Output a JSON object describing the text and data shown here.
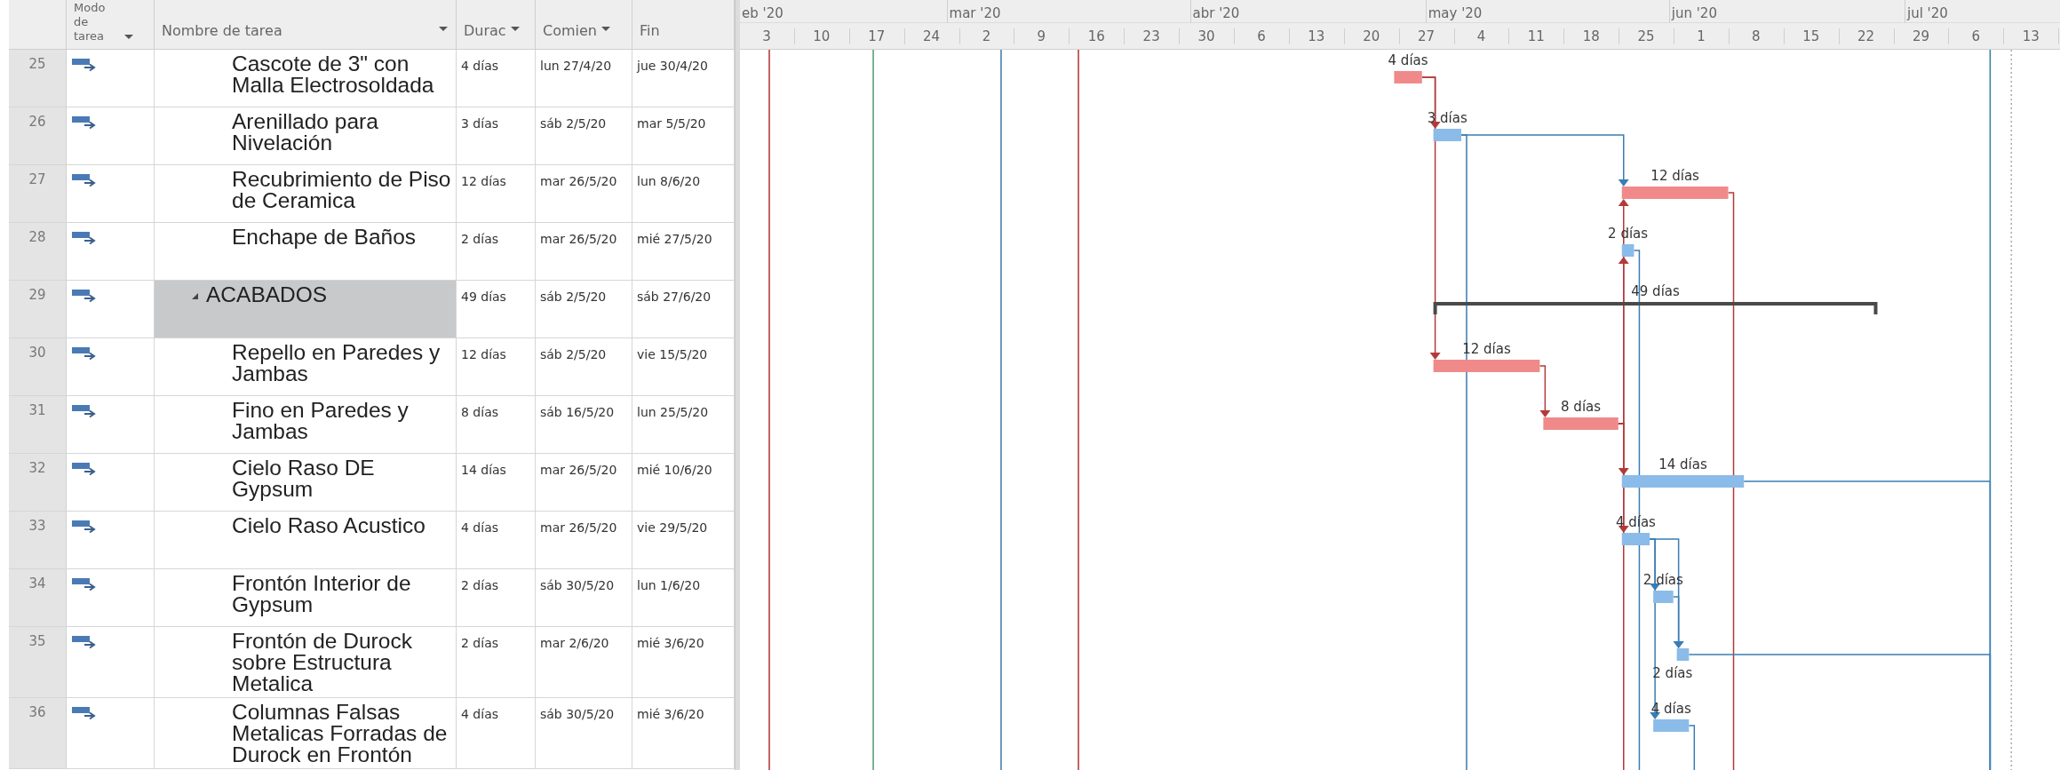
{
  "table": {
    "columns": [
      {
        "label": "Modo de tarea",
        "filter": true
      },
      {
        "label": "Nombre de tarea",
        "filter": true
      },
      {
        "label": "Durac",
        "filter": true
      },
      {
        "label": "Comien",
        "filter": true
      },
      {
        "label": "Fin",
        "filter": false
      }
    ]
  },
  "timescale": {
    "months": [
      "eb '20",
      "mar '20",
      "abr '20",
      "may '20",
      "jun '20",
      "jul '20"
    ],
    "weeks": [
      "3",
      "10",
      "17",
      "24",
      "2",
      "9",
      "16",
      "23",
      "30",
      "6",
      "13",
      "20",
      "27",
      "4",
      "11",
      "18",
      "25",
      "1",
      "8",
      "15",
      "22",
      "29",
      "6",
      "13"
    ]
  },
  "tasks": [
    {
      "kind": "task",
      "row": "25",
      "name": "Cascote de 3\" con Malla Electrosoldada",
      "duration": "4 días",
      "start": "lun 27/4/20",
      "finish": "jue 30/4/20",
      "selected": false,
      "critical": true,
      "bar_label": "4 días",
      "label_below": false
    },
    {
      "kind": "task",
      "row": "26",
      "name": "Arenillado para Nivelación",
      "duration": "3 días",
      "start": "sáb 2/5/20",
      "finish": "mar 5/5/20",
      "selected": false,
      "critical": false,
      "bar_label": "3 días",
      "label_below": false
    },
    {
      "kind": "task",
      "row": "27",
      "name": "Recubrimiento de Piso de Ceramica",
      "duration": "12 días",
      "start": "mar 26/5/20",
      "finish": "lun 8/6/20",
      "selected": false,
      "critical": true,
      "bar_label": "12 días",
      "label_below": false
    },
    {
      "kind": "task",
      "row": "28",
      "name": "Enchape de Baños",
      "duration": "2 días",
      "start": "mar 26/5/20",
      "finish": "mié 27/5/20",
      "selected": false,
      "critical": false,
      "bar_label": "2 días",
      "label_below": false
    },
    {
      "kind": "summary",
      "row": "29",
      "name": "ACABADOS",
      "duration": "49 días",
      "start": "sáb 2/5/20",
      "finish": "sáb 27/6/20",
      "selected": true,
      "expanded": true,
      "bar_label": "49 días",
      "label_below": false,
      "children": [
        {
          "kind": "task",
          "row": "30",
          "name": "Repello en Paredes y Jambas",
          "duration": "12 días",
          "start": "sáb 2/5/20",
          "finish": "vie 15/5/20",
          "selected": false,
          "critical": true,
          "bar_label": "12 días",
          "label_below": false
        },
        {
          "kind": "task",
          "row": "31",
          "name": "Fino en Paredes y Jambas",
          "duration": "8 días",
          "start": "sáb 16/5/20",
          "finish": "lun 25/5/20",
          "selected": false,
          "critical": true,
          "bar_label": "8 días",
          "label_below": false
        },
        {
          "kind": "task",
          "row": "32",
          "name": "Cielo Raso DE Gypsum",
          "duration": "14 días",
          "start": "mar 26/5/20",
          "finish": "mié 10/6/20",
          "selected": false,
          "critical": false,
          "bar_label": "14 días",
          "label_below": false
        },
        {
          "kind": "task",
          "row": "33",
          "name": "Cielo Raso Acustico",
          "duration": "4 días",
          "start": "mar 26/5/20",
          "finish": "vie 29/5/20",
          "selected": false,
          "critical": false,
          "bar_label": "4 días",
          "label_below": false
        },
        {
          "kind": "task",
          "row": "34",
          "name": "Frontón Interior de Gypsum",
          "duration": "2 días",
          "start": "sáb 30/5/20",
          "finish": "lun 1/6/20",
          "selected": false,
          "critical": false,
          "bar_label": "2 días",
          "label_below": false
        },
        {
          "kind": "task",
          "row": "35",
          "name": "Frontón de Durock sobre Estructura Metalica",
          "duration": "2 días",
          "start": "mar 2/6/20",
          "finish": "mié 3/6/20",
          "selected": false,
          "critical": false,
          "bar_label": "2 días",
          "label_below": true
        },
        {
          "kind": "task",
          "row": "36",
          "name": "Columnas Falsas Metalicas Forradas de Durock en Frontón",
          "duration": "4 días",
          "start": "sáb 30/5/20",
          "finish": "mié 3/6/20",
          "selected": false,
          "critical": false,
          "bar_label": "4 días",
          "label_below": false
        }
      ]
    }
  ]
}
